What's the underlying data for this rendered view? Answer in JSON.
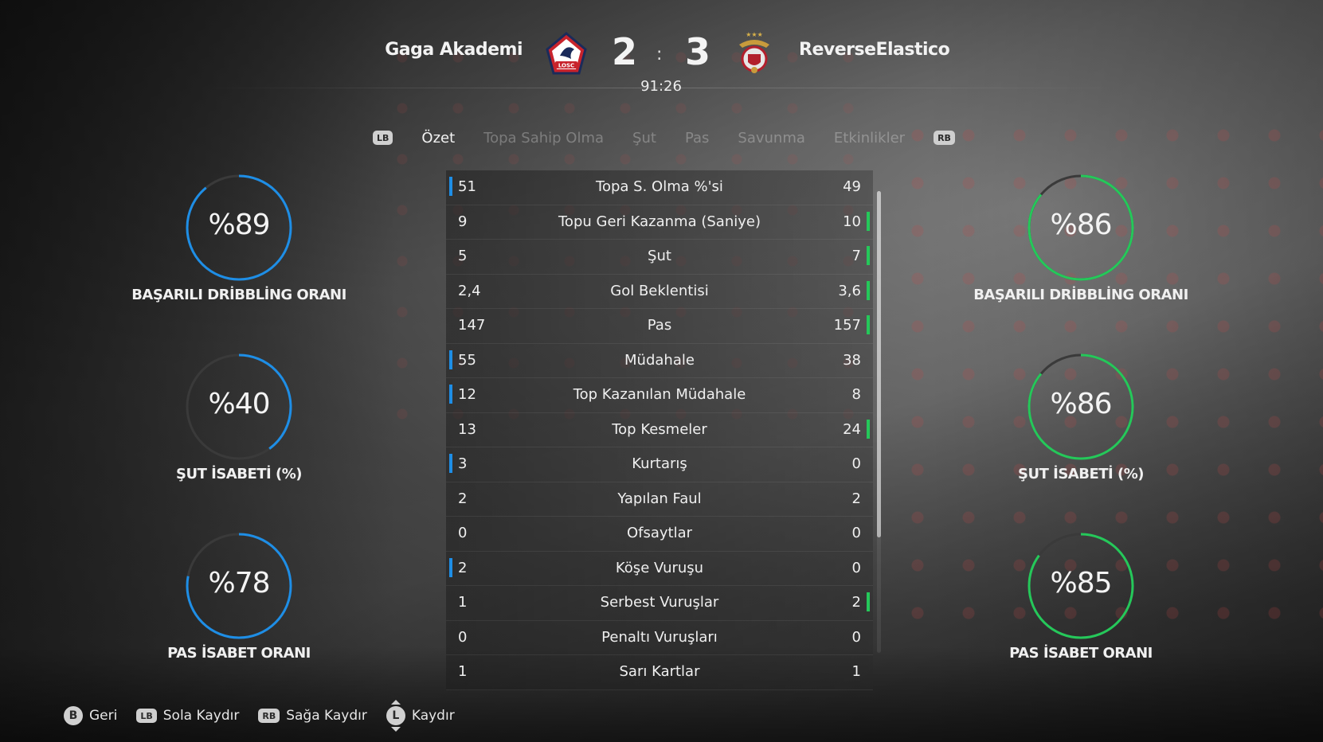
{
  "match": {
    "home_team": "Gaga Akademi",
    "away_team": "ReverseElastico",
    "home_score": "2",
    "away_score": "3",
    "separator": ":",
    "clock": "91:26",
    "home_crest_text": "LOSC"
  },
  "tabs": {
    "lb": "LB",
    "rb": "RB",
    "items": [
      {
        "label": "Özet",
        "active": true
      },
      {
        "label": "Topa Sahip Olma",
        "active": false
      },
      {
        "label": "Şut",
        "active": false
      },
      {
        "label": "Pas",
        "active": false
      },
      {
        "label": "Savunma",
        "active": false
      },
      {
        "label": "Etkinlikler",
        "active": false
      }
    ]
  },
  "stats": [
    {
      "label": "Topa S. Olma %'si",
      "home": "51",
      "away": "49",
      "leader": "home"
    },
    {
      "label": "Topu Geri Kazanma (Saniye)",
      "home": "9",
      "away": "10",
      "leader": "away"
    },
    {
      "label": "Şut",
      "home": "5",
      "away": "7",
      "leader": "away"
    },
    {
      "label": "Gol Beklentisi",
      "home": "2,4",
      "away": "3,6",
      "leader": "away"
    },
    {
      "label": "Pas",
      "home": "147",
      "away": "157",
      "leader": "away"
    },
    {
      "label": "Müdahale",
      "home": "55",
      "away": "38",
      "leader": "home"
    },
    {
      "label": "Top Kazanılan Müdahale",
      "home": "12",
      "away": "8",
      "leader": "home"
    },
    {
      "label": "Top Kesmeler",
      "home": "13",
      "away": "24",
      "leader": "away"
    },
    {
      "label": "Kurtarış",
      "home": "3",
      "away": "0",
      "leader": "home"
    },
    {
      "label": "Yapılan Faul",
      "home": "2",
      "away": "2",
      "leader": "none"
    },
    {
      "label": "Ofsaytlar",
      "home": "0",
      "away": "0",
      "leader": "none"
    },
    {
      "label": "Köşe Vuruşu",
      "home": "2",
      "away": "0",
      "leader": "home"
    },
    {
      "label": "Serbest Vuruşlar",
      "home": "1",
      "away": "2",
      "leader": "away"
    },
    {
      "label": "Penaltı Vuruşları",
      "home": "0",
      "away": "0",
      "leader": "none"
    },
    {
      "label": "Sarı Kartlar",
      "home": "1",
      "away": "1",
      "leader": "none"
    }
  ],
  "home_rings": [
    {
      "value_text": "%89",
      "value": 89,
      "label": "BAŞARILI DRİBBLİNG ORANI"
    },
    {
      "value_text": "%40",
      "value": 40,
      "label": "ŞUT İSABETİ (%)"
    },
    {
      "value_text": "%78",
      "value": 78,
      "label": "PAS İSABET ORANI"
    }
  ],
  "away_rings": [
    {
      "value_text": "%86",
      "value": 86,
      "label": "BAŞARILI DRİBBLİNG ORANI"
    },
    {
      "value_text": "%86",
      "value": 86,
      "label": "ŞUT İSABETİ (%)"
    },
    {
      "value_text": "%85",
      "value": 85,
      "label": "PAS İSABET ORANI"
    }
  ],
  "colors": {
    "home": "#1e8ee6",
    "away": "#25c85a",
    "ring_track": "#3a3a3a"
  },
  "footer": {
    "back_key": "B",
    "back_label": "Geri",
    "left_key": "LB",
    "left_label": "Sola Kaydır",
    "right_key": "RB",
    "right_label": "Sağa Kaydır",
    "scroll_key": "L",
    "scroll_label": "Kaydır"
  }
}
